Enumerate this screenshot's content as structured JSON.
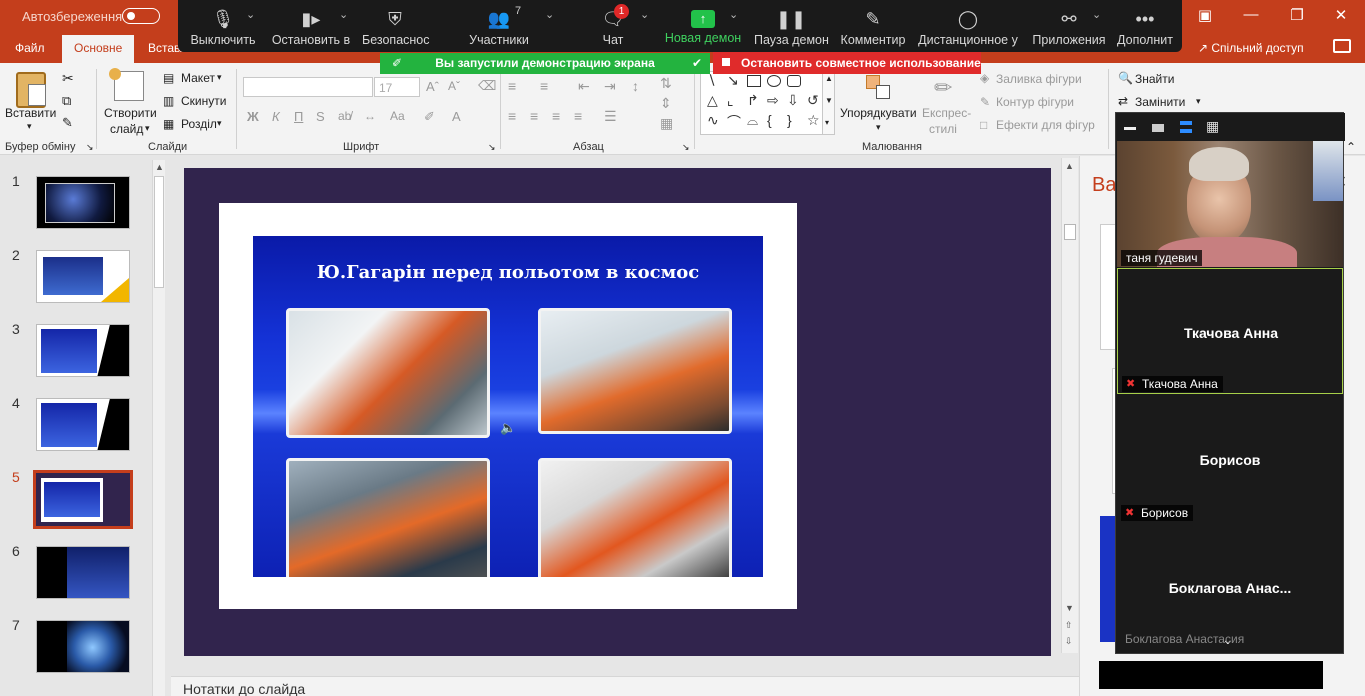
{
  "titlebar": {
    "autosave_label": "Автозбереження",
    "autosave_state": "off"
  },
  "ribbon_tabs": [
    {
      "label": "Файл",
      "active": false
    },
    {
      "label": "Основне",
      "active": true
    },
    {
      "label": "Вставле",
      "active": false
    }
  ],
  "share_button": "Спільний доступ",
  "ribbon": {
    "clipboard": {
      "paste_label": "Вставити",
      "group_label": "Буфер обміну"
    },
    "slides": {
      "new_slide_line1": "Створити",
      "new_slide_line2": "слайд",
      "layout_label": "Макет",
      "reset_label": "Скинути",
      "section_label": "Розділ",
      "group_label": "Слайди"
    },
    "font": {
      "size": "17",
      "bold": "Ж",
      "italic": "К",
      "underline": "П",
      "strike": "S",
      "group_label": "Шрифт"
    },
    "paragraph": {
      "group_label": "Абзац"
    },
    "drawing": {
      "arrange_label": "Упорядкувати",
      "quick_styles_line1": "Експрес-",
      "quick_styles_line2": "стилі",
      "shape_fill": "Заливка фігури",
      "shape_outline": "Контур фігури",
      "shape_effects": "Ефекти для фігур",
      "group_label": "Малювання"
    },
    "editing": {
      "find_label": "Знайти",
      "replace_label": "Замінити"
    }
  },
  "zoom_toolbar": {
    "mute": "Выключить",
    "stop_video": "Остановить в",
    "security": "Безопаснос",
    "participants": "Участники",
    "participants_count": "7",
    "chat": "Чат",
    "chat_badge": "1",
    "new_share": "Новая демон",
    "pause_share": "Пауза демон",
    "annotate": "Комментир",
    "remote_control": "Дистанционное у",
    "apps": "Приложения",
    "more": "Дополнит"
  },
  "sharing_banner": "Вы запустили демонстрацию экрана",
  "stop_share": "Остановить совместное использование",
  "thumbnails": [
    {
      "num": "1",
      "active": false
    },
    {
      "num": "2",
      "active": false
    },
    {
      "num": "3",
      "active": false
    },
    {
      "num": "4",
      "active": false
    },
    {
      "num": "5",
      "active": true
    },
    {
      "num": "6",
      "active": false
    },
    {
      "num": "7",
      "active": false
    }
  ],
  "slide": {
    "title": "Ю.Гагарін перед  польотом в космос"
  },
  "notes_placeholder": "Нотатки до слайда",
  "design_panel": {
    "title": "Ва"
  },
  "gallery": {
    "video_participant": "таня гудевич",
    "tiles": [
      {
        "name": "Ткачова Анна",
        "label": "Ткачова Анна",
        "active": true
      },
      {
        "name": "Борисов",
        "label": "Борисов",
        "active": false
      },
      {
        "name": "Боклагова  Анас...",
        "label": "Боклагова Анастасия",
        "active": false
      }
    ]
  },
  "colors": {
    "accent": "#c43e1c",
    "zoom_green": "#23b33f",
    "zoom_red": "#e02b2b",
    "slide_bg": "#31244d",
    "active_tile_border": "#a7d049"
  }
}
